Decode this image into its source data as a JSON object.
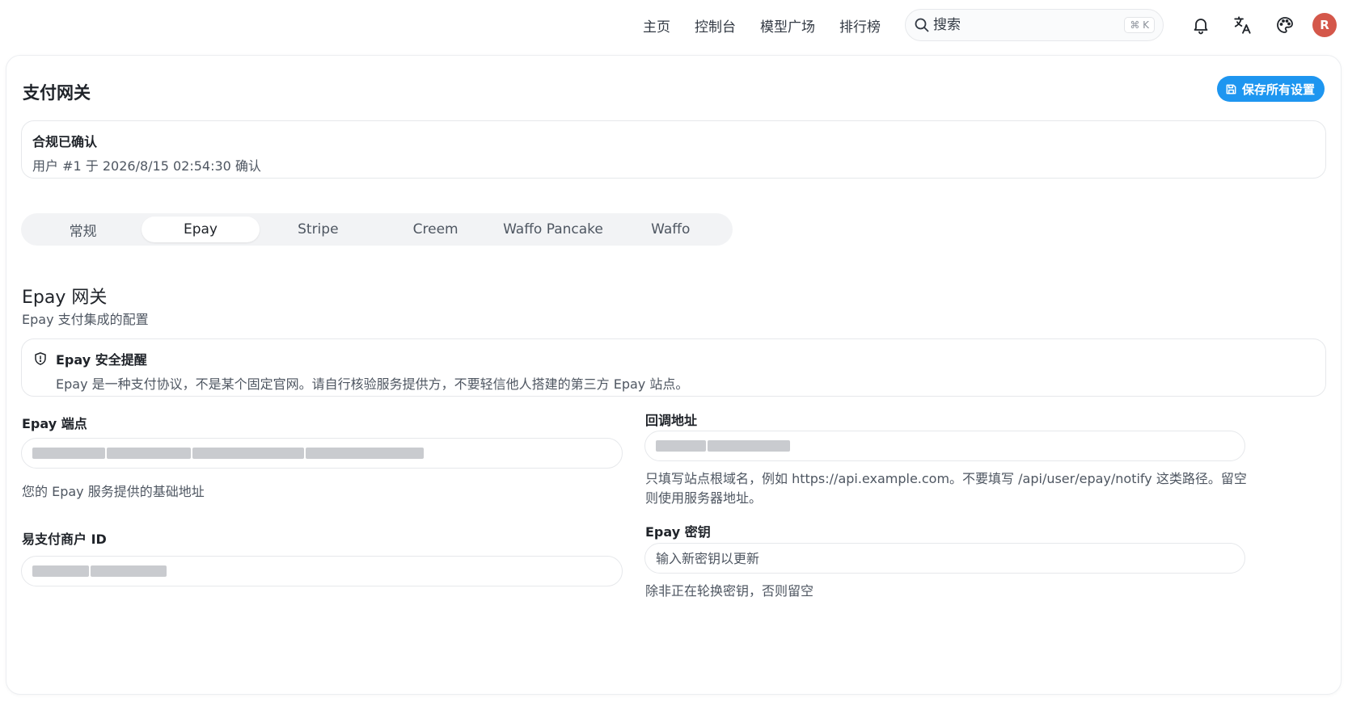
{
  "nav": {
    "links": [
      "主页",
      "控制台",
      "模型广场",
      "排行榜"
    ],
    "search_placeholder": "搜索",
    "search_shortcut": "⌘ K",
    "avatar_letter": "R"
  },
  "page": {
    "title": "支付网关",
    "save_label": "保存所有设置"
  },
  "compliance": {
    "title": "合规已确认",
    "subtitle": "用户 #1 于 2026/8/15 02:54:30 确认"
  },
  "tabs": [
    {
      "label": "常规",
      "active": false
    },
    {
      "label": "Epay",
      "active": true
    },
    {
      "label": "Stripe",
      "active": false
    },
    {
      "label": "Creem",
      "active": false
    },
    {
      "label": "Waffo Pancake",
      "active": false
    },
    {
      "label": "Waffo",
      "active": false
    }
  ],
  "section": {
    "title": "Epay 网关",
    "subtitle": "Epay 支付集成的配置"
  },
  "alert": {
    "title": "Epay 安全提醒",
    "text": "Epay 是一种支付协议，不是某个固定官网。请自行核验服务提供方，不要轻信他人搭建的第三方 Epay 站点。"
  },
  "fields": {
    "endpoint": {
      "label": "Epay 端点",
      "help": "您的 Epay 服务提供的基础地址"
    },
    "merchant_id": {
      "label": "易支付商户 ID"
    },
    "callback": {
      "label": "回调地址",
      "help": "只填写站点根域名，例如 https://api.example.com。不要填写 /api/user/epay/notify 这类路径。留空则使用服务器地址。"
    },
    "secret": {
      "label": "Epay 密钥",
      "placeholder": "输入新密钥以更新",
      "help": "除非正在轮换密钥，否则留空"
    }
  },
  "colors": {
    "accent": "#1e96f0",
    "avatar": "#d4574a"
  }
}
